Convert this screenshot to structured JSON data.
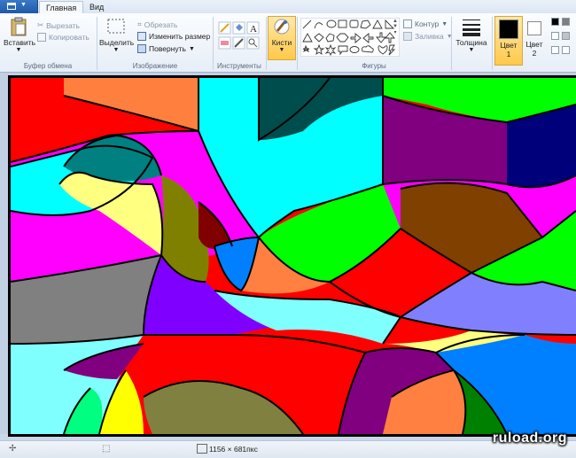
{
  "tabs": [
    {
      "label": "Главная",
      "active": true
    },
    {
      "label": "Вид",
      "active": false
    }
  ],
  "clipboard": {
    "paste": "Вставить",
    "cut": "Вырезать",
    "copy": "Копировать",
    "group": "Буфер обмена"
  },
  "image": {
    "select": "Выделить",
    "crop": "Обрезать",
    "resize": "Изменить размер",
    "rotate": "Повернуть",
    "group": "Изображение"
  },
  "tools": {
    "group": "Инструменты"
  },
  "brushes": {
    "label": "Кисти"
  },
  "shapes": {
    "outline": "Контур",
    "fill": "Заливка",
    "group": "Фигуры"
  },
  "size": {
    "label": "Толщина"
  },
  "colors": {
    "color1_label": "Цвет",
    "color1_num": "1",
    "color2_label": "Цвет",
    "color2_num": "2",
    "color1": "#000000",
    "color2": "#ffffff"
  },
  "status": {
    "dimensions": "1156 × 681пкс"
  },
  "watermark": "ruload.org"
}
